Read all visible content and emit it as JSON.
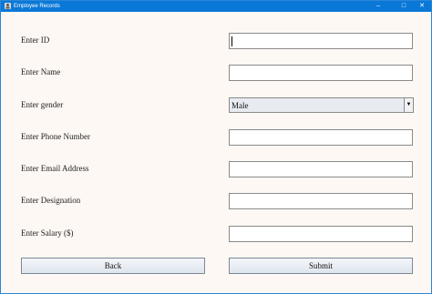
{
  "window": {
    "title": "Employee Records",
    "minimize_glyph": "–",
    "maximize_glyph": "□",
    "close_glyph": "✕"
  },
  "form": {
    "id_label": "Enter ID",
    "id_value": "",
    "name_label": "Enter Name",
    "name_value": "",
    "gender_label": "Enter gender",
    "gender_value": "Male",
    "gender_arrow": "▼",
    "phone_label": "Enter Phone Number",
    "phone_value": "",
    "email_label": "Enter Email Address",
    "email_value": "",
    "designation_label": "Enter Designation",
    "designation_value": "",
    "salary_label": "Enter Salary ($)",
    "salary_value": ""
  },
  "buttons": {
    "back_label": "Back",
    "submit_label": "Submit"
  },
  "colors": {
    "titlebar": "#0a78d7",
    "form_background": "#fdf8f4"
  },
  "icons": {
    "app": "app-window-icon",
    "dropdown": "chevron-down-icon"
  }
}
